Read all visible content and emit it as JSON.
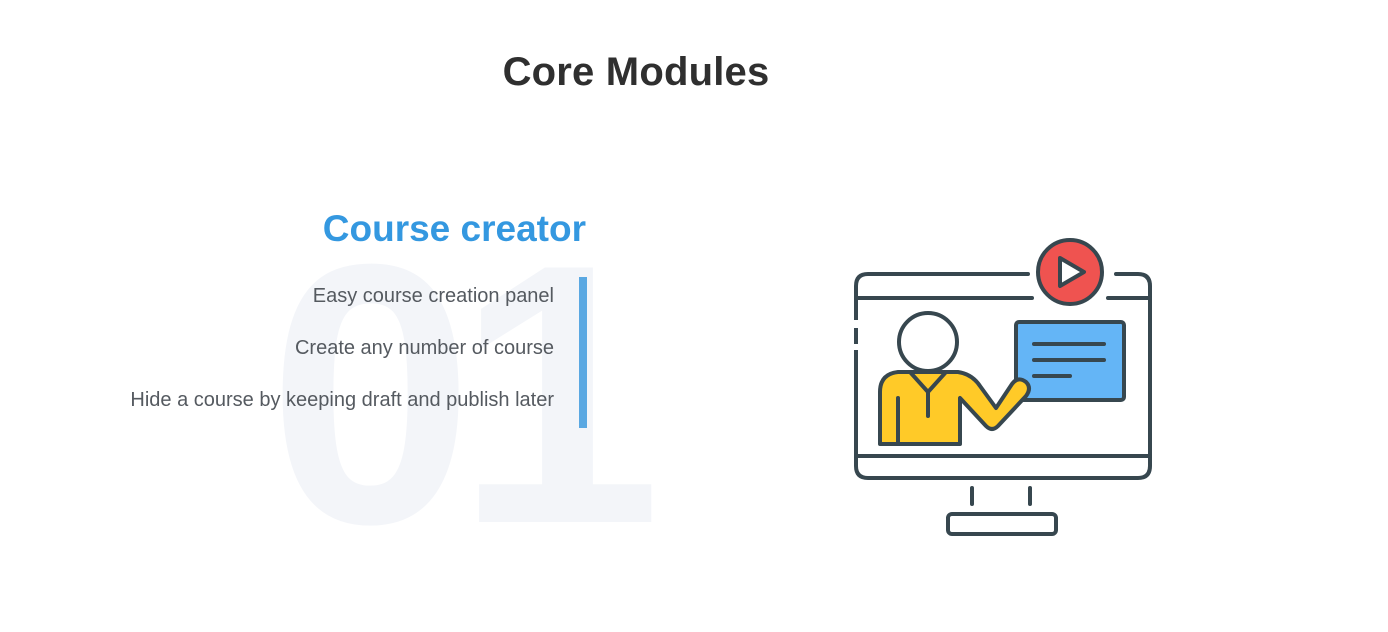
{
  "section": {
    "title": "Core Modules"
  },
  "module": {
    "number": "01",
    "title": "Course creator",
    "features": [
      "Easy course creation panel",
      "Create any number of course",
      "Hide a course by keeping draft and publish later"
    ],
    "accent_color": "#3498e0",
    "bar_color": "#5aa8e2"
  },
  "illustration": {
    "icon": "online-course-monitor-icon",
    "colors": {
      "outline": "#37474f",
      "play": "#ef5350",
      "board": "#64b5f6",
      "shirt": "#ffca28"
    }
  }
}
